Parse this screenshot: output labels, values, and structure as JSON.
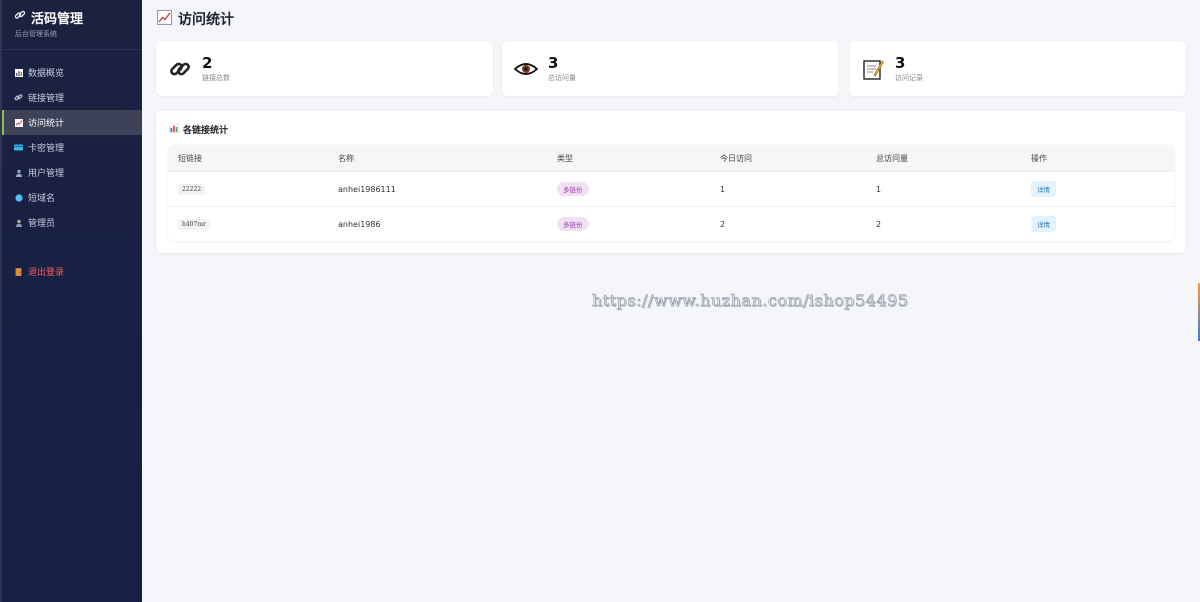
{
  "sidebar": {
    "brand_title": "活码管理",
    "brand_sub": "后台管理系统",
    "items": [
      {
        "label": "数据概览",
        "icon": "bar-chart-icon"
      },
      {
        "label": "链接管理",
        "icon": "link-icon"
      },
      {
        "label": "访问统计",
        "icon": "trend-chart-icon",
        "active": true
      },
      {
        "label": "卡密管理",
        "icon": "card-icon"
      },
      {
        "label": "用户管理",
        "icon": "user-icon"
      },
      {
        "label": "短域名",
        "icon": "globe-dot-icon"
      },
      {
        "label": "管理员",
        "icon": "admin-user-icon"
      }
    ],
    "logout_label": "退出登录"
  },
  "main": {
    "page_title": "访问统计",
    "stats": [
      {
        "value": "2",
        "label": "链接总数",
        "icon": "chain-icon"
      },
      {
        "value": "3",
        "label": "总访问量",
        "icon": "eye-icon"
      },
      {
        "value": "3",
        "label": "访问记录",
        "icon": "memo-icon"
      }
    ],
    "panel_title": "各链接统计",
    "table": {
      "headers": [
        "短链接",
        "名称",
        "类型",
        "今日访问",
        "总访问量",
        "操作"
      ],
      "rows": [
        {
          "code": "22222",
          "name": "anhei1986111",
          "type": "多链份",
          "today": "1",
          "total": "1",
          "action": "详情"
        },
        {
          "code": "h407mr",
          "name": "anhei1986",
          "type": "多链份",
          "today": "2",
          "total": "2",
          "action": "详情"
        }
      ]
    }
  },
  "watermark": "https://www.huzhan.com/ishop54495",
  "colors": {
    "sidebar_bg": "#1c2140",
    "active_indicator": "#8bc34a",
    "logout": "#ff5b5b",
    "badge": "#9b3dad",
    "detail": "#2b7bbd"
  }
}
